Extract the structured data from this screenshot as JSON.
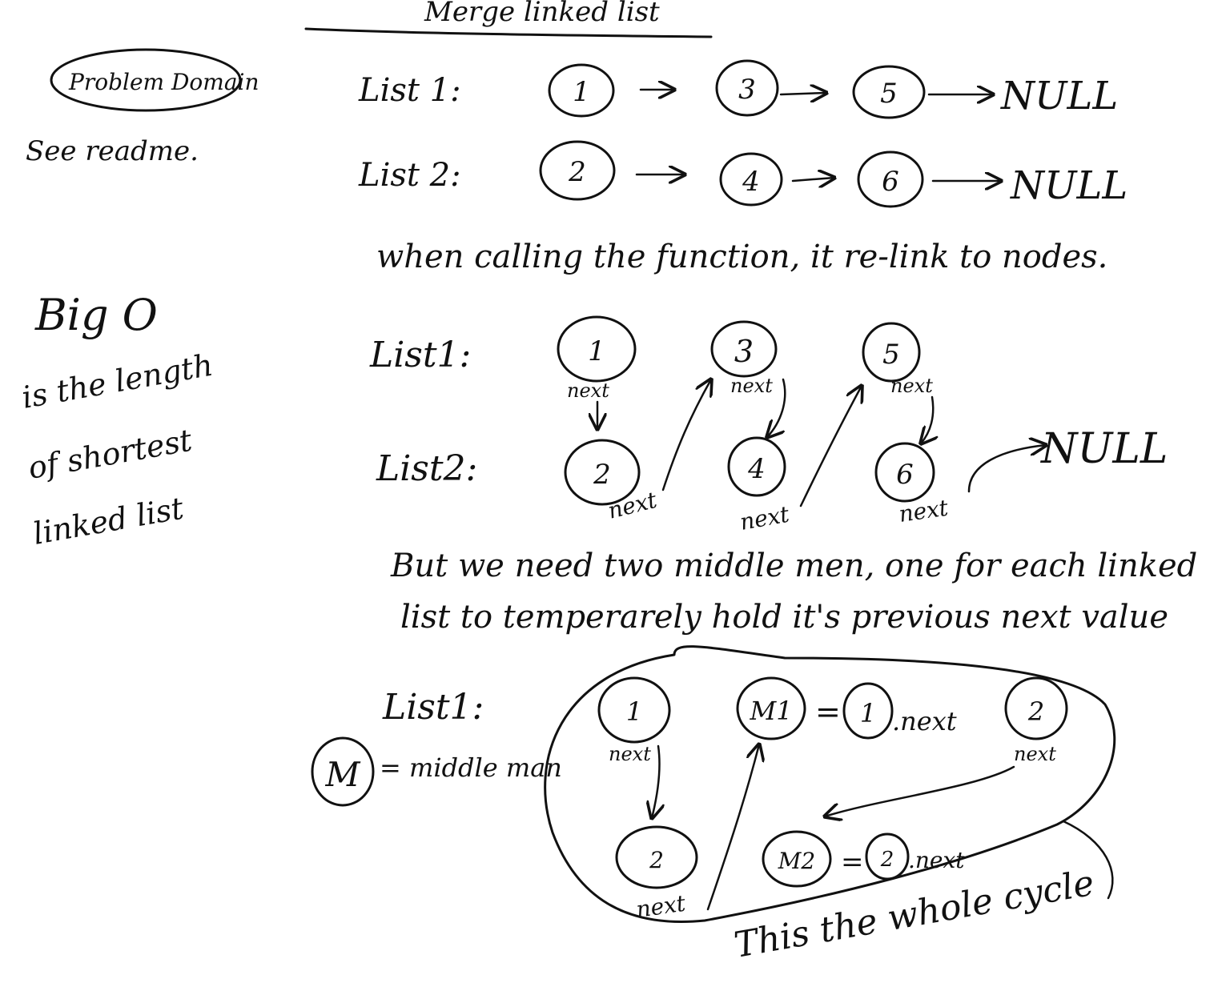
{
  "title": "Merge linked list",
  "problem_domain": {
    "label": "Problem Domain",
    "note": "See readme."
  },
  "big_o": {
    "heading": "Big O",
    "lines": [
      "is the length",
      "of shortest",
      "linked list"
    ]
  },
  "section1": {
    "list1_label": "List 1:",
    "list2_label": "List 2:",
    "list1_nodes": [
      "1",
      "3",
      "5"
    ],
    "list2_nodes": [
      "2",
      "4",
      "6"
    ],
    "null_label": "NULL"
  },
  "caption1": "when calling the function, it re-link to nodes.",
  "section2": {
    "list1_label": "List1:",
    "list2_label": "List2:",
    "list1_nodes": [
      "1",
      "3",
      "5"
    ],
    "list2_nodes": [
      "2",
      "4",
      "6"
    ],
    "next_label": "next",
    "null_label": "NULL"
  },
  "caption2": {
    "line1": "But we need two middle men, one for each linked",
    "line2": "list to temperarely hold it's previous next value"
  },
  "section3": {
    "list1_label": "List1:",
    "legend_symbol": "M",
    "legend_text": "= middle man",
    "node_1": "1",
    "m1": "M1",
    "m1_eq_node": "1",
    "m1_eq_suffix": ".next",
    "equals": "=",
    "node_2_top": "2",
    "node_2_bottom": "2",
    "m2": "M2",
    "m2_eq_node": "2",
    "m2_eq_suffix": ".next",
    "next_label": "next",
    "cycle_caption": "This the whole cycle"
  }
}
